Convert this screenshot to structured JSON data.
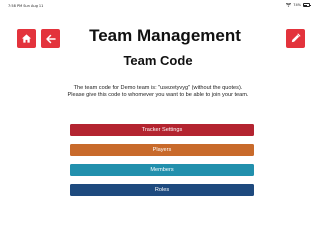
{
  "status_bar": {
    "time": "7:58 PM  Sun Aug 11",
    "battery": "74%"
  },
  "header": {
    "title": "Team Management"
  },
  "page": {
    "title": "Team Code",
    "info_line1": "The team code for Demo team is: \"usezetyvyg\" (without the quotes).",
    "info_line2": "Please give this code to whomever you want to be able to join your team."
  },
  "menu": {
    "tracker_settings": "Tracker Settings",
    "players": "Players",
    "members": "Members",
    "roles": "Roles"
  },
  "colors": {
    "nav_button": "#e3333c",
    "tracker_settings": "#b32430",
    "players": "#c86a2b",
    "members": "#2290ad",
    "roles": "#1e4a7e"
  },
  "icons": {
    "home": "home-icon",
    "back": "arrow-left-icon",
    "edit": "pencil-icon"
  }
}
